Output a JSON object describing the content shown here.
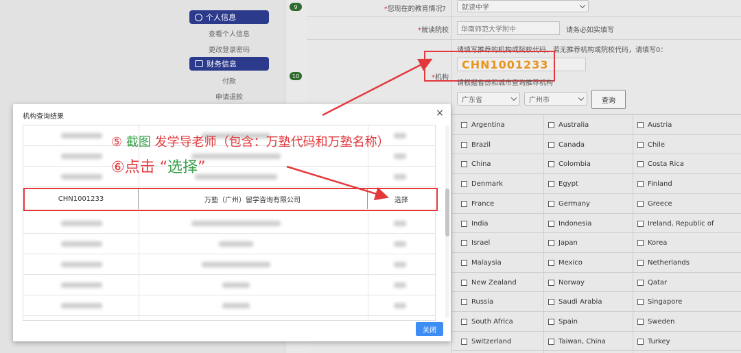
{
  "sidebar": {
    "personal_info_label": "个人信息",
    "view_personal_info": "查看个人信息",
    "change_password": "更改登录密码",
    "finance_info_label": "财务信息",
    "payment": "付款",
    "refund": "申请退款"
  },
  "steps": [
    "9",
    "10"
  ],
  "form": {
    "education_label": "您现在的教育情况?",
    "education_value": "就读中学",
    "school_label": "就读院校",
    "school_value": "华南师范大学附中",
    "school_note": "请务必如实填写",
    "agency_instruction": "请填写推荐的机构或院校代码，若无推荐机构或院校代码，请填写0：",
    "agency_label": "机构",
    "agency_code": "CHN1001233",
    "province_hint": "请根据省份和城市查询推荐机构",
    "province_value": "广东省",
    "city_value": "广州市",
    "query_button": "查询"
  },
  "countries": [
    [
      "Argentina",
      "Australia",
      "Austria"
    ],
    [
      "Brazil",
      "Canada",
      "Chile"
    ],
    [
      "China",
      "Colombia",
      "Costa Rica"
    ],
    [
      "Denmark",
      "Egypt",
      "Finland"
    ],
    [
      "France",
      "Germany",
      "Greece"
    ],
    [
      "India",
      "Indonesia",
      "Ireland, Republic of"
    ],
    [
      "Israel",
      "Japan",
      "Korea"
    ],
    [
      "Malaysia",
      "Mexico",
      "Netherlands"
    ],
    [
      "New Zealand",
      "Norway",
      "Qatar"
    ],
    [
      "Russia",
      "Saudi Arabia",
      "Singapore"
    ],
    [
      "South Africa",
      "Spain",
      "Sweden"
    ],
    [
      "Switzerland",
      "Taiwan, China",
      "Turkey"
    ]
  ],
  "modal": {
    "title": "机构查询结果",
    "close_symbol": "×",
    "highlight_row": {
      "code": "CHN1001233",
      "name": "万塾（广州）留学咨询有限公司",
      "action": "选择"
    },
    "close_button": "关闭"
  },
  "annotations": {
    "step5_prefix": "⑤ ",
    "step5_green": "截图",
    "step5_rest": " 发学导老师（包含：万塾代码和万塾名称）",
    "step6_prefix": "⑥点击 “",
    "step6_green": "选择",
    "step6_suffix": "”"
  },
  "colors": {
    "annotation_red": "#e3393c",
    "annotation_green": "#3aa14a",
    "sidebar_button": "#2c3a8c",
    "code_orange": "#e8941d",
    "close_button": "#3d8df5"
  }
}
